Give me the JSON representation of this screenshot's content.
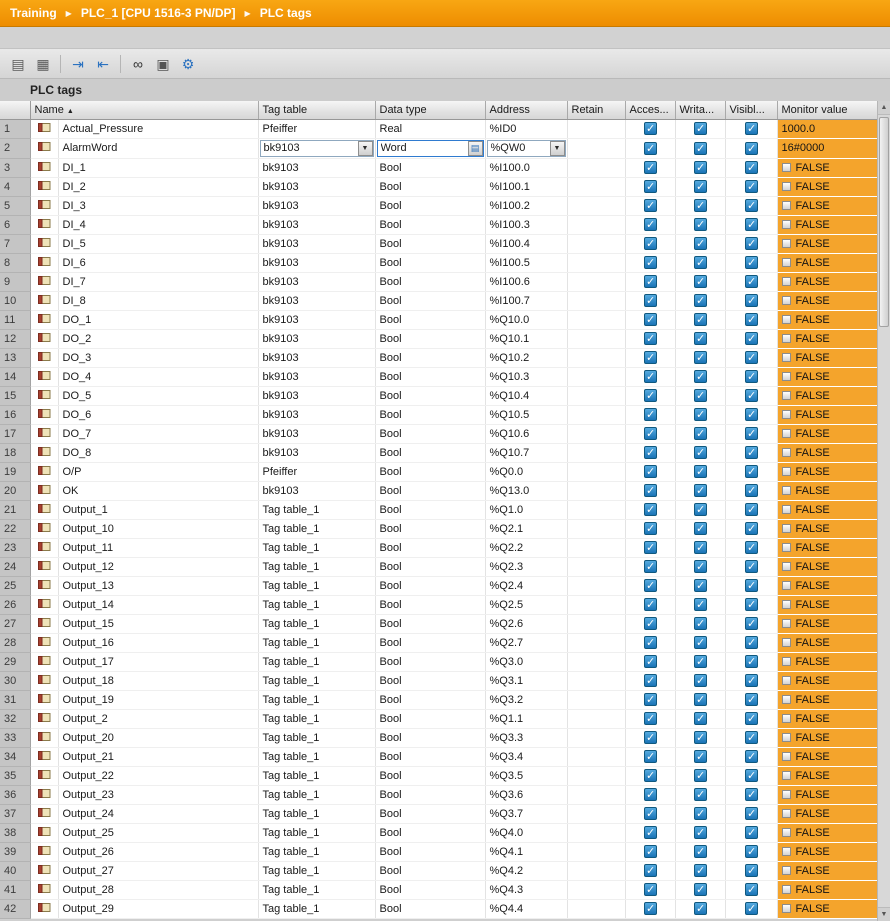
{
  "colors": {
    "accent_orange": "#ee8d00",
    "accent_orange_light": "#f8a713",
    "monitor_orange": "#f4a42c",
    "checkbox_blue": "#1a74b6",
    "checkbox_blue_light": "#55aadf"
  },
  "breadcrumb": {
    "items": [
      "Training",
      "PLC_1 [CPU 1516-3 PN/DP]",
      "PLC tags"
    ],
    "separator": "▶"
  },
  "toolbar": {
    "icons": [
      {
        "name": "insert-row-icon",
        "glyph": "▤",
        "color": "#5a5a5a"
      },
      {
        "name": "add-row-icon",
        "glyph": "▦",
        "color": "#5a5a5a"
      },
      {
        "name": "export-icon",
        "glyph": "⇥",
        "color": "#2b72c0"
      },
      {
        "name": "import-icon",
        "glyph": "⇤",
        "color": "#2b72c0"
      },
      {
        "name": "monitor-all-icon",
        "glyph": "∞",
        "color": "#333333"
      },
      {
        "name": "snapshot-icon",
        "glyph": "▣",
        "color": "#555555"
      },
      {
        "name": "cross-reference-icon",
        "glyph": "⚙",
        "color": "#2b72c0"
      }
    ]
  },
  "section_title": "PLC tags",
  "table": {
    "columns": [
      "Name",
      "Tag table",
      "Data type",
      "Address",
      "Retain",
      "Acces...",
      "Writa...",
      "Visibl...",
      "Monitor value"
    ],
    "sort": {
      "column": "Name",
      "direction": "asc",
      "glyph": "▲"
    },
    "dropdown_glyph": "▼",
    "selector_glyph": "▤",
    "rows": [
      {
        "num": "1",
        "name": "Actual_Pressure",
        "tag_table": "Pfeiffer",
        "data_type": "Real",
        "address": "%ID0",
        "retain": false,
        "accessible": true,
        "writable": true,
        "visible": true,
        "monitor_value": "1000.0",
        "monitor_is_bool": false
      },
      {
        "num": "2",
        "name": "AlarmWord",
        "tag_table": "bk9103",
        "data_type": "Word",
        "address": "%QW0",
        "retain": false,
        "accessible": true,
        "writable": true,
        "visible": true,
        "monitor_value": "16#0000",
        "monitor_is_bool": false,
        "editing": true
      },
      {
        "num": "3",
        "name": "DI_1",
        "tag_table": "bk9103",
        "data_type": "Bool",
        "address": "%I100.0",
        "retain": false,
        "accessible": true,
        "writable": true,
        "visible": true,
        "monitor_value": "FALSE",
        "monitor_is_bool": true
      },
      {
        "num": "4",
        "name": "DI_2",
        "tag_table": "bk9103",
        "data_type": "Bool",
        "address": "%I100.1",
        "retain": false,
        "accessible": true,
        "writable": true,
        "visible": true,
        "monitor_value": "FALSE",
        "monitor_is_bool": true
      },
      {
        "num": "5",
        "name": "DI_3",
        "tag_table": "bk9103",
        "data_type": "Bool",
        "address": "%I100.2",
        "retain": false,
        "accessible": true,
        "writable": true,
        "visible": true,
        "monitor_value": "FALSE",
        "monitor_is_bool": true
      },
      {
        "num": "6",
        "name": "DI_4",
        "tag_table": "bk9103",
        "data_type": "Bool",
        "address": "%I100.3",
        "retain": false,
        "accessible": true,
        "writable": true,
        "visible": true,
        "monitor_value": "FALSE",
        "monitor_is_bool": true
      },
      {
        "num": "7",
        "name": "DI_5",
        "tag_table": "bk9103",
        "data_type": "Bool",
        "address": "%I100.4",
        "retain": false,
        "accessible": true,
        "writable": true,
        "visible": true,
        "monitor_value": "FALSE",
        "monitor_is_bool": true
      },
      {
        "num": "8",
        "name": "DI_6",
        "tag_table": "bk9103",
        "data_type": "Bool",
        "address": "%I100.5",
        "retain": false,
        "accessible": true,
        "writable": true,
        "visible": true,
        "monitor_value": "FALSE",
        "monitor_is_bool": true
      },
      {
        "num": "9",
        "name": "DI_7",
        "tag_table": "bk9103",
        "data_type": "Bool",
        "address": "%I100.6",
        "retain": false,
        "accessible": true,
        "writable": true,
        "visible": true,
        "monitor_value": "FALSE",
        "monitor_is_bool": true
      },
      {
        "num": "10",
        "name": "DI_8",
        "tag_table": "bk9103",
        "data_type": "Bool",
        "address": "%I100.7",
        "retain": false,
        "accessible": true,
        "writable": true,
        "visible": true,
        "monitor_value": "FALSE",
        "monitor_is_bool": true
      },
      {
        "num": "11",
        "name": "DO_1",
        "tag_table": "bk9103",
        "data_type": "Bool",
        "address": "%Q10.0",
        "retain": false,
        "accessible": true,
        "writable": true,
        "visible": true,
        "monitor_value": "FALSE",
        "monitor_is_bool": true
      },
      {
        "num": "12",
        "name": "DO_2",
        "tag_table": "bk9103",
        "data_type": "Bool",
        "address": "%Q10.1",
        "retain": false,
        "accessible": true,
        "writable": true,
        "visible": true,
        "monitor_value": "FALSE",
        "monitor_is_bool": true
      },
      {
        "num": "13",
        "name": "DO_3",
        "tag_table": "bk9103",
        "data_type": "Bool",
        "address": "%Q10.2",
        "retain": false,
        "accessible": true,
        "writable": true,
        "visible": true,
        "monitor_value": "FALSE",
        "monitor_is_bool": true
      },
      {
        "num": "14",
        "name": "DO_4",
        "tag_table": "bk9103",
        "data_type": "Bool",
        "address": "%Q10.3",
        "retain": false,
        "accessible": true,
        "writable": true,
        "visible": true,
        "monitor_value": "FALSE",
        "monitor_is_bool": true
      },
      {
        "num": "15",
        "name": "DO_5",
        "tag_table": "bk9103",
        "data_type": "Bool",
        "address": "%Q10.4",
        "retain": false,
        "accessible": true,
        "writable": true,
        "visible": true,
        "monitor_value": "FALSE",
        "monitor_is_bool": true
      },
      {
        "num": "16",
        "name": "DO_6",
        "tag_table": "bk9103",
        "data_type": "Bool",
        "address": "%Q10.5",
        "retain": false,
        "accessible": true,
        "writable": true,
        "visible": true,
        "monitor_value": "FALSE",
        "monitor_is_bool": true
      },
      {
        "num": "17",
        "name": "DO_7",
        "tag_table": "bk9103",
        "data_type": "Bool",
        "address": "%Q10.6",
        "retain": false,
        "accessible": true,
        "writable": true,
        "visible": true,
        "monitor_value": "FALSE",
        "monitor_is_bool": true
      },
      {
        "num": "18",
        "name": "DO_8",
        "tag_table": "bk9103",
        "data_type": "Bool",
        "address": "%Q10.7",
        "retain": false,
        "accessible": true,
        "writable": true,
        "visible": true,
        "monitor_value": "FALSE",
        "monitor_is_bool": true
      },
      {
        "num": "19",
        "name": "O/P",
        "tag_table": "Pfeiffer",
        "data_type": "Bool",
        "address": "%Q0.0",
        "retain": false,
        "accessible": true,
        "writable": true,
        "visible": true,
        "monitor_value": "FALSE",
        "monitor_is_bool": true
      },
      {
        "num": "20",
        "name": "OK",
        "tag_table": "bk9103",
        "data_type": "Bool",
        "address": "%Q13.0",
        "retain": false,
        "accessible": true,
        "writable": true,
        "visible": true,
        "monitor_value": "FALSE",
        "monitor_is_bool": true
      },
      {
        "num": "21",
        "name": "Output_1",
        "tag_table": "Tag table_1",
        "data_type": "Bool",
        "address": "%Q1.0",
        "retain": false,
        "accessible": true,
        "writable": true,
        "visible": true,
        "monitor_value": "FALSE",
        "monitor_is_bool": true
      },
      {
        "num": "22",
        "name": "Output_10",
        "tag_table": "Tag table_1",
        "data_type": "Bool",
        "address": "%Q2.1",
        "retain": false,
        "accessible": true,
        "writable": true,
        "visible": true,
        "monitor_value": "FALSE",
        "monitor_is_bool": true
      },
      {
        "num": "23",
        "name": "Output_11",
        "tag_table": "Tag table_1",
        "data_type": "Bool",
        "address": "%Q2.2",
        "retain": false,
        "accessible": true,
        "writable": true,
        "visible": true,
        "monitor_value": "FALSE",
        "monitor_is_bool": true
      },
      {
        "num": "24",
        "name": "Output_12",
        "tag_table": "Tag table_1",
        "data_type": "Bool",
        "address": "%Q2.3",
        "retain": false,
        "accessible": true,
        "writable": true,
        "visible": true,
        "monitor_value": "FALSE",
        "monitor_is_bool": true
      },
      {
        "num": "25",
        "name": "Output_13",
        "tag_table": "Tag table_1",
        "data_type": "Bool",
        "address": "%Q2.4",
        "retain": false,
        "accessible": true,
        "writable": true,
        "visible": true,
        "monitor_value": "FALSE",
        "monitor_is_bool": true
      },
      {
        "num": "26",
        "name": "Output_14",
        "tag_table": "Tag table_1",
        "data_type": "Bool",
        "address": "%Q2.5",
        "retain": false,
        "accessible": true,
        "writable": true,
        "visible": true,
        "monitor_value": "FALSE",
        "monitor_is_bool": true
      },
      {
        "num": "27",
        "name": "Output_15",
        "tag_table": "Tag table_1",
        "data_type": "Bool",
        "address": "%Q2.6",
        "retain": false,
        "accessible": true,
        "writable": true,
        "visible": true,
        "monitor_value": "FALSE",
        "monitor_is_bool": true
      },
      {
        "num": "28",
        "name": "Output_16",
        "tag_table": "Tag table_1",
        "data_type": "Bool",
        "address": "%Q2.7",
        "retain": false,
        "accessible": true,
        "writable": true,
        "visible": true,
        "monitor_value": "FALSE",
        "monitor_is_bool": true
      },
      {
        "num": "29",
        "name": "Output_17",
        "tag_table": "Tag table_1",
        "data_type": "Bool",
        "address": "%Q3.0",
        "retain": false,
        "accessible": true,
        "writable": true,
        "visible": true,
        "monitor_value": "FALSE",
        "monitor_is_bool": true
      },
      {
        "num": "30",
        "name": "Output_18",
        "tag_table": "Tag table_1",
        "data_type": "Bool",
        "address": "%Q3.1",
        "retain": false,
        "accessible": true,
        "writable": true,
        "visible": true,
        "monitor_value": "FALSE",
        "monitor_is_bool": true
      },
      {
        "num": "31",
        "name": "Output_19",
        "tag_table": "Tag table_1",
        "data_type": "Bool",
        "address": "%Q3.2",
        "retain": false,
        "accessible": true,
        "writable": true,
        "visible": true,
        "monitor_value": "FALSE",
        "monitor_is_bool": true
      },
      {
        "num": "32",
        "name": "Output_2",
        "tag_table": "Tag table_1",
        "data_type": "Bool",
        "address": "%Q1.1",
        "retain": false,
        "accessible": true,
        "writable": true,
        "visible": true,
        "monitor_value": "FALSE",
        "monitor_is_bool": true
      },
      {
        "num": "33",
        "name": "Output_20",
        "tag_table": "Tag table_1",
        "data_type": "Bool",
        "address": "%Q3.3",
        "retain": false,
        "accessible": true,
        "writable": true,
        "visible": true,
        "monitor_value": "FALSE",
        "monitor_is_bool": true
      },
      {
        "num": "34",
        "name": "Output_21",
        "tag_table": "Tag table_1",
        "data_type": "Bool",
        "address": "%Q3.4",
        "retain": false,
        "accessible": true,
        "writable": true,
        "visible": true,
        "monitor_value": "FALSE",
        "monitor_is_bool": true
      },
      {
        "num": "35",
        "name": "Output_22",
        "tag_table": "Tag table_1",
        "data_type": "Bool",
        "address": "%Q3.5",
        "retain": false,
        "accessible": true,
        "writable": true,
        "visible": true,
        "monitor_value": "FALSE",
        "monitor_is_bool": true
      },
      {
        "num": "36",
        "name": "Output_23",
        "tag_table": "Tag table_1",
        "data_type": "Bool",
        "address": "%Q3.6",
        "retain": false,
        "accessible": true,
        "writable": true,
        "visible": true,
        "monitor_value": "FALSE",
        "monitor_is_bool": true
      },
      {
        "num": "37",
        "name": "Output_24",
        "tag_table": "Tag table_1",
        "data_type": "Bool",
        "address": "%Q3.7",
        "retain": false,
        "accessible": true,
        "writable": true,
        "visible": true,
        "monitor_value": "FALSE",
        "monitor_is_bool": true
      },
      {
        "num": "38",
        "name": "Output_25",
        "tag_table": "Tag table_1",
        "data_type": "Bool",
        "address": "%Q4.0",
        "retain": false,
        "accessible": true,
        "writable": true,
        "visible": true,
        "monitor_value": "FALSE",
        "monitor_is_bool": true
      },
      {
        "num": "39",
        "name": "Output_26",
        "tag_table": "Tag table_1",
        "data_type": "Bool",
        "address": "%Q4.1",
        "retain": false,
        "accessible": true,
        "writable": true,
        "visible": true,
        "monitor_value": "FALSE",
        "monitor_is_bool": true
      },
      {
        "num": "40",
        "name": "Output_27",
        "tag_table": "Tag table_1",
        "data_type": "Bool",
        "address": "%Q4.2",
        "retain": false,
        "accessible": true,
        "writable": true,
        "visible": true,
        "monitor_value": "FALSE",
        "monitor_is_bool": true
      },
      {
        "num": "41",
        "name": "Output_28",
        "tag_table": "Tag table_1",
        "data_type": "Bool",
        "address": "%Q4.3",
        "retain": false,
        "accessible": true,
        "writable": true,
        "visible": true,
        "monitor_value": "FALSE",
        "monitor_is_bool": true
      },
      {
        "num": "42",
        "name": "Output_29",
        "tag_table": "Tag table_1",
        "data_type": "Bool",
        "address": "%Q4.4",
        "retain": false,
        "accessible": true,
        "writable": true,
        "visible": true,
        "monitor_value": "FALSE",
        "monitor_is_bool": true
      }
    ]
  }
}
